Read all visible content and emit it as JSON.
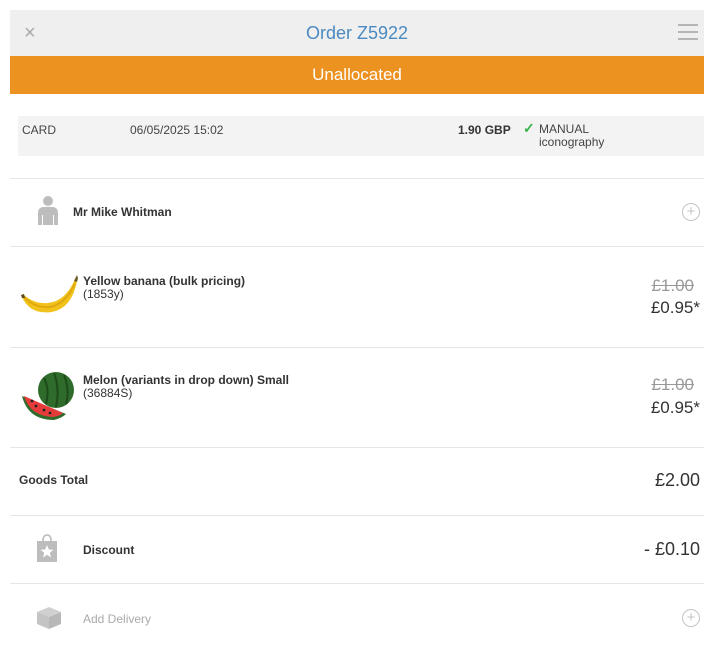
{
  "header": {
    "title": "Order Z5922",
    "close_icon": "×"
  },
  "status": {
    "label": "Unallocated",
    "color": "#ec9220"
  },
  "payment": {
    "method": "CARD",
    "date": "06/05/2025 15:02",
    "amount": "1.90 GBP",
    "check_icon": "✓",
    "status_line1": "MANUAL",
    "status_line2": "iconography"
  },
  "customer": {
    "name": "Mr Mike Whitman",
    "icon": "person-icon",
    "add_icon": "+"
  },
  "items": [
    {
      "name": "Yellow banana (bulk pricing)",
      "code": "(1853y)",
      "old_price": "£1.00",
      "new_price": "£0.95*",
      "image": "banana-image"
    },
    {
      "name": "Melon (variants in drop down) Small",
      "code": "(36884S)",
      "old_price": "£1.00",
      "new_price": "£0.95*",
      "image": "watermelon-image"
    }
  ],
  "totals": {
    "goods_label": "Goods Total",
    "goods_value": "£2.00",
    "discount_label": "Discount",
    "discount_value": "- £0.10",
    "delivery_label": "Add Delivery",
    "delivery_add_icon": "+"
  }
}
